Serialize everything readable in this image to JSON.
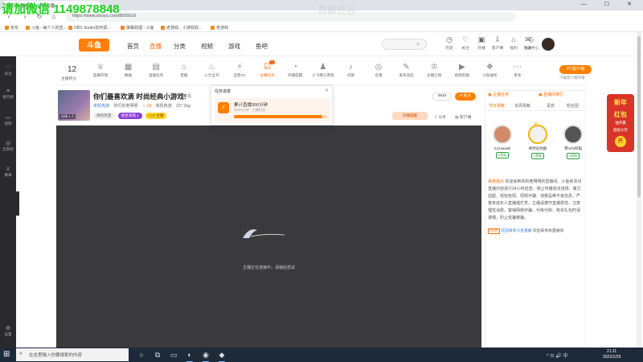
{
  "watermark": {
    "primary": "请加微信 1149878848",
    "secondary": "苔藓狂谷"
  },
  "browser": {
    "tab_title": "你们最喜欢滴 - 斗鱼直播",
    "controls": "— ☐ ✕",
    "url": "https://www.douyu.com/8500016",
    "bookmarks": [
      "京东",
      "斗鱼 - 每个人的直...",
      "OBS Studio如何调...",
      "弹幕助理 - 斗鱼",
      "老游戏、小游戏收...",
      "老游戏"
    ]
  },
  "header": {
    "logo": "斗鱼",
    "nav": [
      "首页",
      "直播",
      "分类",
      "视频",
      "游戏",
      "鱼吧"
    ],
    "active_nav": "直播",
    "search_placeholder": "搜索",
    "icons": [
      {
        "icon": "history-icon",
        "label": "历史"
      },
      {
        "icon": "heart-icon",
        "label": "关注"
      },
      {
        "icon": "live-icon",
        "label": "开播"
      },
      {
        "icon": "download-icon",
        "label": "客户端"
      },
      {
        "icon": "gift-icon",
        "label": "福利"
      },
      {
        "icon": "message-icon",
        "label": "消息"
      },
      {
        "icon": "diamond-icon",
        "label": "会员中心"
      }
    ]
  },
  "sidebar": [
    {
      "icon": "heart-icon",
      "label": "关注"
    },
    {
      "icon": "list-icon",
      "label": "排行榜"
    },
    {
      "icon": "video-icon",
      "label": "视频"
    },
    {
      "icon": "gamepad-icon",
      "label": "云游戏"
    },
    {
      "icon": "trophy-icon",
      "label": "赛事"
    },
    {
      "icon": "settings-icon",
      "label": "设置"
    }
  ],
  "toolbar": {
    "score": "12",
    "score_label": "主播积分",
    "items": [
      {
        "icon": "trophy-icon",
        "label": "直播开放"
      },
      {
        "icon": "chart-icon",
        "label": "数据"
      },
      {
        "icon": "calendar-icon",
        "label": "直播任务"
      },
      {
        "icon": "gift-icon",
        "label": "宝箱"
      },
      {
        "icon": "fire-icon",
        "label": "火力全开"
      },
      {
        "icon": "lightning-icon",
        "label": "全民PK"
      },
      {
        "icon": "task-icon",
        "label": "主播任务",
        "active": true,
        "badge": "1"
      },
      {
        "icon": "alarm-icon",
        "label": "开播提醒"
      },
      {
        "icon": "game-icon",
        "label": "小飞猪小游戏"
      },
      {
        "icon": "music-icon",
        "label": "点歌"
      },
      {
        "icon": "target-icon",
        "label": "竞猜"
      },
      {
        "icon": "star-icon",
        "label": "发布动态"
      },
      {
        "icon": "cup-icon",
        "label": "主播订阅"
      },
      {
        "icon": "video-icon",
        "label": "视频剪辑"
      },
      {
        "icon": "lottery-icon",
        "label": "斗鱼抽奖"
      },
      {
        "icon": "more-icon",
        "label": "更多"
      }
    ],
    "pc_button": "PC客户端",
    "pc_sub": "下载客户端开播"
  },
  "room": {
    "thumb_tag": "在线 1 人",
    "title": "你们最喜欢滴 时尚经典小游戏!",
    "report": "举报",
    "meta_category": "单机热游",
    "meta_streamer": "你们的老明明",
    "meta_hot": "24",
    "meta_rank": "单机热游",
    "meta_weight": "227.2kg",
    "tags": [
      "单机热游",
      "福星高照 1",
      "LV1 主播"
    ],
    "follow_count": "4810",
    "follow_label": "关注",
    "reserve": "开播提醒",
    "share": "分享",
    "client": "客户端"
  },
  "popup": {
    "title": "任务进度",
    "task_text": "累计直播300分钟",
    "task_sub": "0/300分钟 · 主播任务",
    "progress": 0.95
  },
  "video": {
    "status": "主播正在连接中，请稍后尝试"
  },
  "right_panel": {
    "badge_left": "主播任务",
    "badge_right": "直播间排行",
    "tabs": [
      "今日贡献",
      "本周贡献",
      "贵宾",
      "粉丝团"
    ],
    "active_tab": "今日贡献",
    "ranks": [
      {
        "name": "2124ao88",
        "tag": "1贵族"
      },
      {
        "name": "林然说你娘",
        "tag": "2贵族"
      },
      {
        "name": "零n4hi阿猫",
        "tag": "3贵族"
      }
    ],
    "system_header": "系统提示",
    "system_text": "欢迎来到你的老明明的直播间。斗鱼依法对直播内容进行24小时巡查，禁止传播违法违规、暴力血腥、低俗色情、招嫖诈骗、违禁品等不良信息。严禁未成年人直播或打赏。主播请遵守直播规范，注意理性消费。警惕网络诈骗，代练代购、购买礼包时请谨慎，防止受骗被骗。",
    "welcome_level": "LV10",
    "welcome_name": "欢迎来到斗鱼直播",
    "welcome_text": "欢迎来到本直播间"
  },
  "promo": {
    "line1": "新年",
    "line2": "红包",
    "line3": "抽奖赢",
    "line4": "超级大奖",
    "button": "开"
  },
  "taskbar": {
    "search_placeholder": "在这里输入你要搜索的内容",
    "time": "21:11",
    "date": "2022/1/29",
    "tray": "^ ⊡ 🔊 中"
  }
}
